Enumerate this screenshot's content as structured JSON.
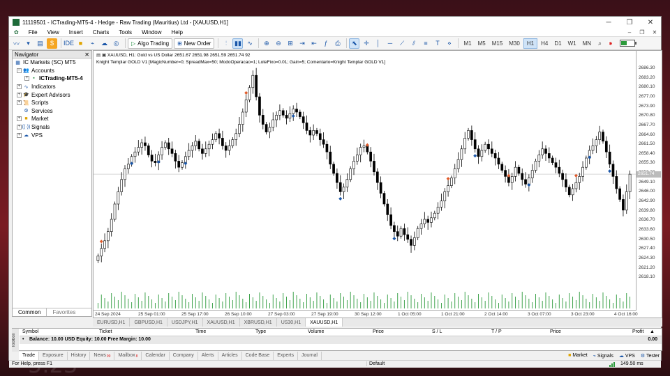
{
  "background": {
    "number": "5.23"
  },
  "window": {
    "title": "11119501 - ICTrading-MT5-4 - Hedge - Raw Trading (Mauritius) Ltd - [XAUUSD,H1]"
  },
  "menu": [
    "File",
    "View",
    "Insert",
    "Charts",
    "Tools",
    "Window",
    "Help"
  ],
  "toolbar": {
    "ide": "IDE",
    "algo_trading": "Algo Trading",
    "new_order": "New Order",
    "notification_count": "1"
  },
  "timeframes": [
    "M1",
    "M5",
    "M15",
    "M30",
    "H1",
    "H4",
    "D1",
    "W1",
    "MN"
  ],
  "navigator": {
    "title": "Navigator",
    "items": [
      "IC Markets (SC) MT5",
      "Accounts",
      "ICTrading-MT5-4",
      "Indicators",
      "Expert Advisors",
      "Scripts",
      "Services",
      "Market",
      "Signals",
      "VPS"
    ],
    "tabs": [
      "Common",
      "Favorites"
    ]
  },
  "chart": {
    "header": "XAUUSD, H1:  Gold vs US Dollar  2651.67 2651.98 2651.59 2651.74  92",
    "expert_line": "Knight Templar GOLD V1 [MagicNumber=0; SpreadMax=50; ModoOperacao=1; LoteFixo=0.01; Gain=5; Comentario=Knight Templar GOLD V1]",
    "current_price": "2651.74",
    "tabs": [
      "EURUSD,H1",
      "GBPUSD,H1",
      "USDJPY,H1",
      "XAUUSD,H1",
      "XBRUSD,H1",
      "US30,H1",
      "XAUUSD,H1"
    ],
    "active_tab": 6
  },
  "chart_data": {
    "type": "candlestick",
    "symbol": "XAUUSD",
    "timeframe": "H1",
    "y_ticks": [
      "2686.30",
      "2683.20",
      "2680.10",
      "2677.00",
      "2673.90",
      "2670.80",
      "2667.70",
      "2664.60",
      "2661.50",
      "2658.40",
      "2655.30",
      "2652.20",
      "2649.10",
      "2646.00",
      "2642.90",
      "2639.80",
      "2636.70",
      "2633.60",
      "2630.50",
      "2627.40",
      "2624.30",
      "2621.20",
      "2618.10"
    ],
    "x_ticks": [
      "24 Sep 2024",
      "25 Sep 01:00",
      "25 Sep 17:00",
      "26 Sep 10:00",
      "27 Sep 03:00",
      "27 Sep 19:00",
      "30 Sep 12:00",
      "1 Oct 05:00",
      "1 Oct 21:00",
      "2 Oct 14:00",
      "3 Oct 07:00",
      "3 Oct 23:00",
      "4 Oct 16:00"
    ],
    "ylim": [
      2617.0,
      2687.0
    ],
    "closes": [
      2625.0,
      2627.5,
      2630.0,
      2633.0,
      2637.0,
      2642.0,
      2646.0,
      2650.0,
      2653.5,
      2655.0,
      2657.5,
      2659.0,
      2660.5,
      2662.0,
      2661.0,
      2658.0,
      2656.0,
      2655.5,
      2658.0,
      2660.5,
      2662.0,
      2660.0,
      2658.5,
      2656.0,
      2654.0,
      2655.5,
      2657.5,
      2659.5,
      2661.0,
      2662.5,
      2660.0,
      2658.5,
      2660.0,
      2661.5,
      2663.0,
      2665.0,
      2663.5,
      2661.0,
      2659.5,
      2661.0,
      2663.0,
      2665.0,
      2668.0,
      2672.0,
      2676.0,
      2680.0,
      2684.0,
      2677.0,
      2671.0,
      2668.0,
      2665.5,
      2667.0,
      2669.5,
      2671.0,
      2672.5,
      2671.0,
      2670.0,
      2671.5,
      2673.0,
      2672.0,
      2670.5,
      2668.5,
      2666.0,
      2664.5,
      2666.0,
      2665.0,
      2663.0,
      2661.5,
      2659.0,
      2655.0,
      2652.0,
      2649.0,
      2646.0,
      2647.5,
      2650.0,
      2653.5,
      2656.0,
      2658.0,
      2660.5,
      2661.0,
      2659.0,
      2656.0,
      2652.5,
      2649.0,
      2645.5,
      2642.0,
      2638.5,
      2635.0,
      2633.0,
      2631.5,
      2634.0,
      2632.0,
      2630.5,
      2628.5,
      2631.0,
      2634.0,
      2635.5,
      2637.0,
      2636.0,
      2637.5,
      2639.0,
      2641.0,
      2643.0,
      2646.0,
      2648.0,
      2650.5,
      2653.5,
      2656.5,
      2660.0,
      2663.5,
      2666.0,
      2663.0,
      2660.0,
      2657.5,
      2659.5,
      2661.5,
      2660.0,
      2658.5,
      2657.0,
      2655.0,
      2653.0,
      2651.0,
      2649.0,
      2651.0,
      2654.0,
      2652.0,
      2650.0,
      2648.5,
      2650.5,
      2653.0,
      2656.0,
      2658.0,
      2660.0,
      2658.5,
      2657.0,
      2655.5,
      2654.0,
      2652.0,
      2650.0,
      2647.5,
      2645.0,
      2647.0,
      2649.0,
      2651.0,
      2654.0,
      2657.0,
      2659.5,
      2661.0,
      2663.0,
      2665.5,
      2662.5,
      2659.0,
      2655.0,
      2651.0,
      2647.0,
      2643.5,
      2640.0,
      2646.0,
      2651.74
    ]
  },
  "toolbox": {
    "label": "Toolbox",
    "columns": [
      "Symbol",
      "Ticket",
      "Time",
      "Type",
      "Volume",
      "Price",
      "S / L",
      "T / P",
      "Price",
      "Profit"
    ],
    "balance_row": "Balance: 10.00 USD  Equity: 10.00  Free Margin: 10.00",
    "balance_profit": "0.00",
    "tabs": [
      "Trade",
      "Exposure",
      "History",
      "News",
      "Mailbox",
      "Calendar",
      "Company",
      "Alerts",
      "Articles",
      "Code Base",
      "Experts",
      "Journal"
    ],
    "news_count": "99",
    "mailbox_count": "8",
    "right_links": [
      "Market",
      "Signals",
      "VPS",
      "Tester"
    ]
  },
  "status": {
    "help": "For Help, press F1",
    "profile": "Default",
    "ping": "149.50 ms"
  },
  "colors": {
    "bull": "#ffffff",
    "bear": "#000000",
    "volume": "#2c9a3b",
    "signal_buy": "#1a56a8",
    "signal_sell": "#e05a2a"
  }
}
